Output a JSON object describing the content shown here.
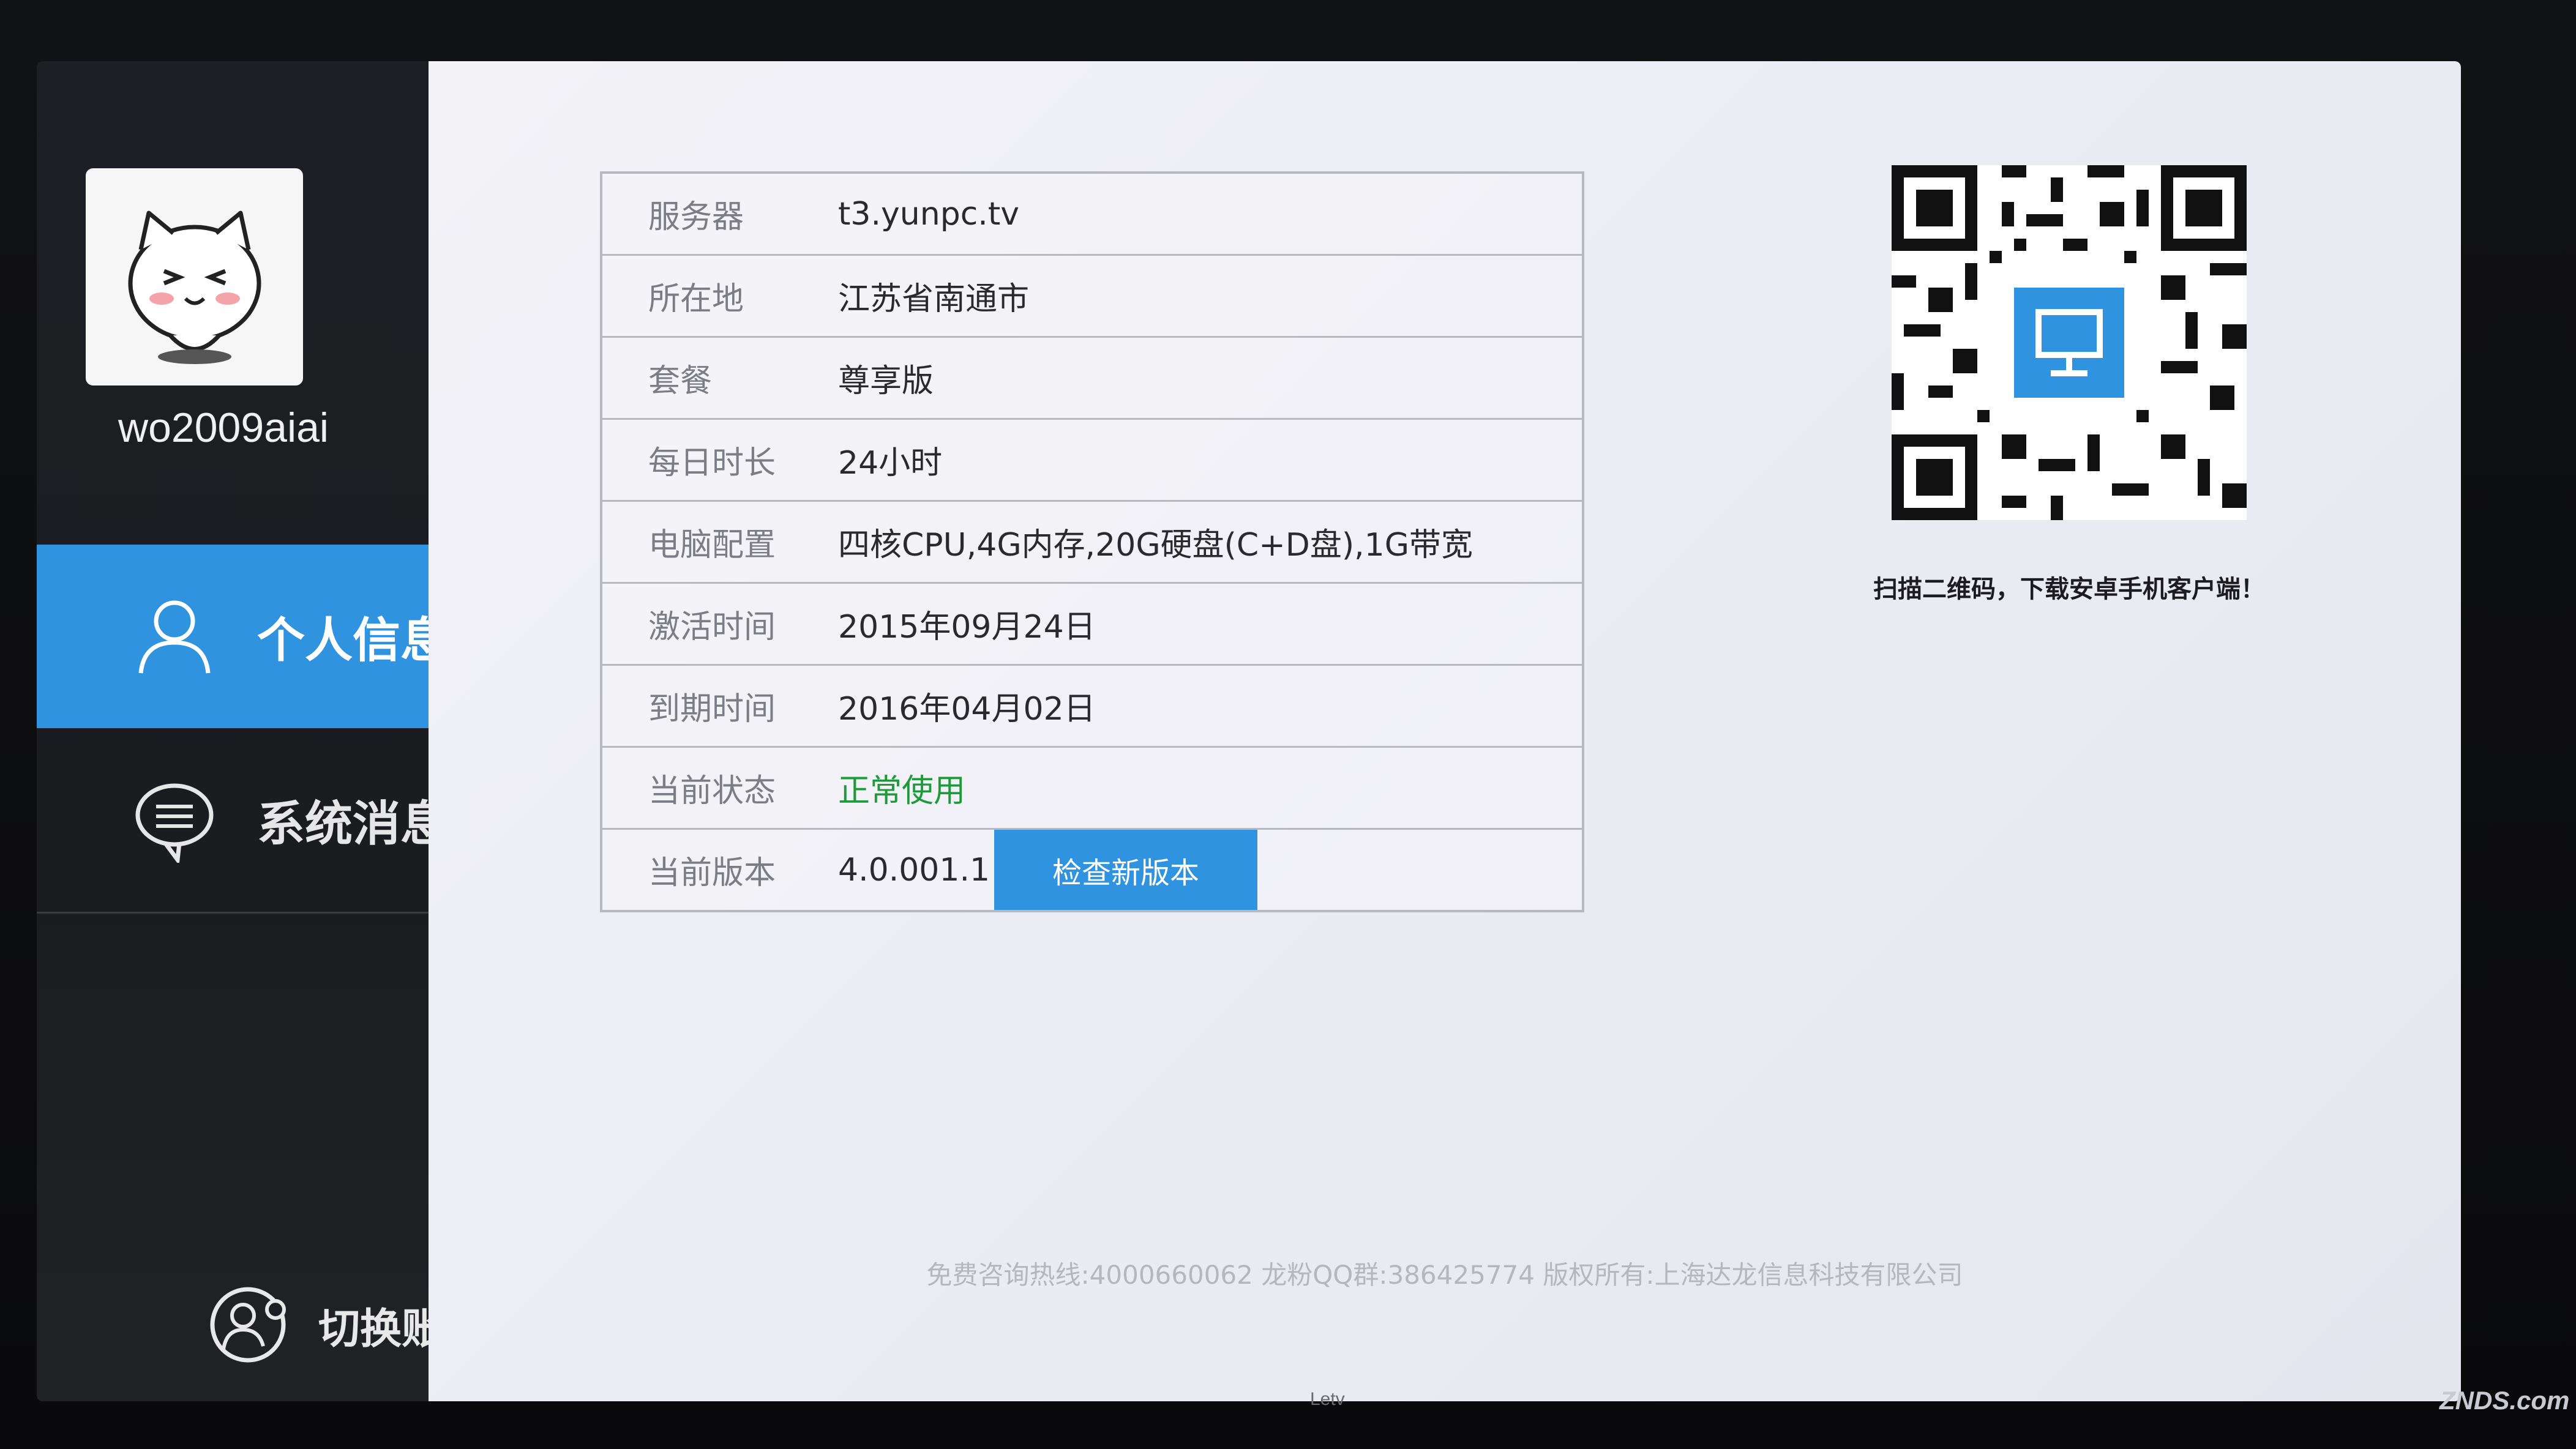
{
  "sidebar": {
    "username": "wo2009aiai",
    "nav_items": [
      {
        "label": "个人信息",
        "icon": "person-icon",
        "active": true
      },
      {
        "label": "系统消息",
        "icon": "chat-bubble-icon",
        "active": false
      }
    ],
    "switch_account_label": "切换账号",
    "switch_account_icon": "switch-user-icon"
  },
  "info": {
    "rows": [
      {
        "label": "服务器",
        "value": "t3.yunpc.tv"
      },
      {
        "label": "所在地",
        "value": "江苏省南通市"
      },
      {
        "label": "套餐",
        "value": "尊享版"
      },
      {
        "label": "每日时长",
        "value": "24小时"
      },
      {
        "label": "电脑配置",
        "value": "四核CPU,4G内存,20G硬盘(C+D盘),1G带宽"
      },
      {
        "label": "激活时间",
        "value": "2015年09月24日"
      },
      {
        "label": "到期时间",
        "value": "2016年04月02日"
      },
      {
        "label": "当前状态",
        "value": "正常使用"
      },
      {
        "label": "当前版本",
        "value": "4.0.001.1"
      }
    ],
    "check_update_label": "检查新版本"
  },
  "qr": {
    "caption": "扫描二维码，下载安卓手机客户端！"
  },
  "footer": {
    "text": "免费咨询热线:4000660062 龙粉QQ群:386425774 版权所有:上海达龙信息科技有限公司"
  },
  "tv_brand": "Letv",
  "watermark": "ZNDS.com",
  "colors": {
    "accent": "#2f93e0",
    "status_ok": "#1f9a3a",
    "sidebar_bg": "#1d1f24",
    "panel_bg": "#ececf4"
  }
}
